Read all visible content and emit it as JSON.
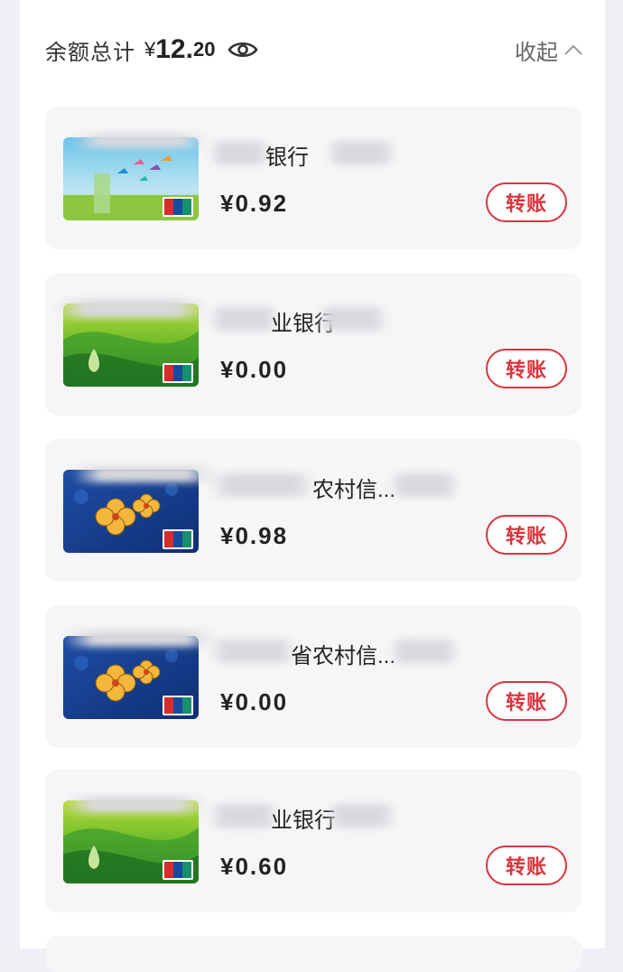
{
  "header": {
    "total_label": "余额总计",
    "currency": "¥",
    "amount_int": "12.",
    "amount_dec": "20",
    "collapse_label": "收起",
    "eye_icon": "eye-icon",
    "chevron_icon": "chevron-up-icon"
  },
  "cards": [
    {
      "name": "银行",
      "balance": "¥0.92",
      "transfer": "转账",
      "art": "birds"
    },
    {
      "name": "业银行",
      "balance": "¥0.00",
      "transfer": "转账",
      "art": "green-drop"
    },
    {
      "name": "农村信...",
      "balance": "¥0.98",
      "transfer": "转账",
      "art": "blue-flower"
    },
    {
      "name": "省农村信...",
      "balance": "¥0.00",
      "transfer": "转账",
      "art": "blue-flower"
    },
    {
      "name": "业银行",
      "balance": "¥0.60",
      "transfer": "转账",
      "art": "green-drop"
    }
  ],
  "colors": {
    "accent": "#d9363e",
    "card_bg": "#f6f6f8"
  }
}
